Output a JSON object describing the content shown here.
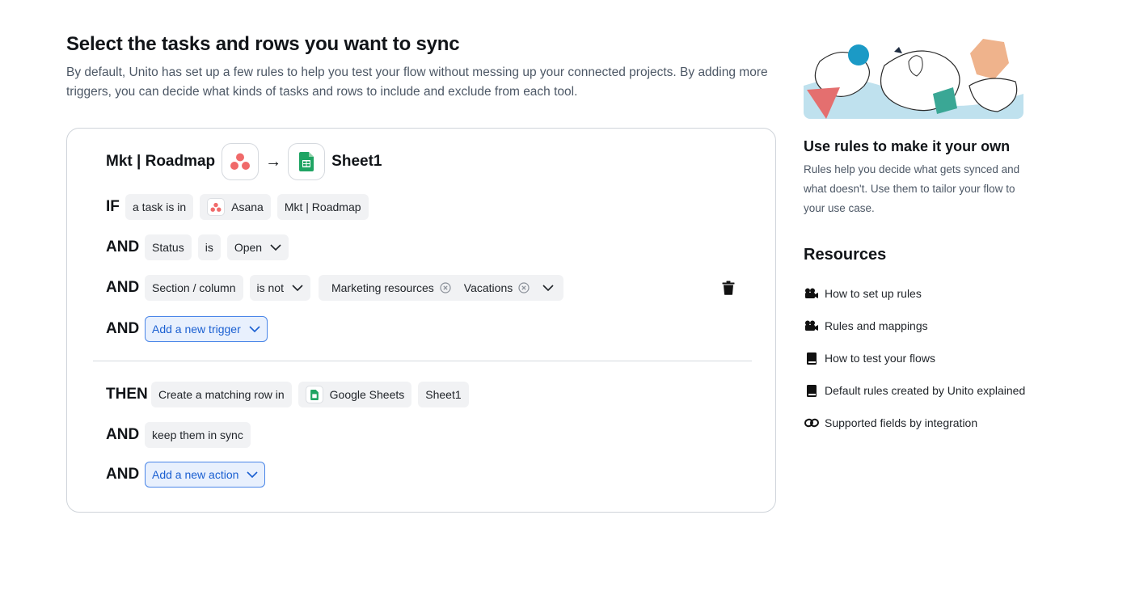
{
  "page": {
    "title": "Select the tasks and rows you want to sync",
    "description": "By default, Unito has set up a few rules to help you test your flow without messing up your connected projects. By adding more triggers, you can decide what kinds of tasks and rows to include and exclude from each tool."
  },
  "flow": {
    "source_name": "Mkt | Roadmap",
    "arrow": "→",
    "target_name": "Sheet1"
  },
  "triggers": {
    "if_keyword": "IF",
    "if_chip": "a task is in",
    "if_tool": "Asana",
    "if_project": "Mkt | Roadmap",
    "status": {
      "keyword": "AND",
      "field": "Status",
      "operator": "is",
      "value": "Open"
    },
    "section": {
      "keyword": "AND",
      "field": "Section / column",
      "operator": "is not",
      "values": [
        "Marketing resources",
        "Vacations"
      ]
    },
    "add": {
      "keyword": "AND",
      "label": "Add a new trigger"
    }
  },
  "actions": {
    "then_keyword": "THEN",
    "then_chip": "Create a matching row in",
    "then_tool": "Google Sheets",
    "then_sheet": "Sheet1",
    "sync": {
      "keyword": "AND",
      "label": "keep them in sync"
    },
    "add": {
      "keyword": "AND",
      "label": "Add a new action"
    }
  },
  "sidebar": {
    "title": "Use rules to make it your own",
    "description": "Rules help you decide what gets synced and what doesn't. Use them to tailor your flow to your use case.",
    "resources_title": "Resources",
    "resources": [
      {
        "label": "How to set up rules",
        "icon": "video-icon"
      },
      {
        "label": "Rules and mappings",
        "icon": "video-icon"
      },
      {
        "label": "How to test your flows",
        "icon": "book-icon"
      },
      {
        "label": "Default rules created by Unito explained",
        "icon": "book-icon"
      },
      {
        "label": "Supported fields by integration",
        "icon": "link-icon"
      }
    ]
  },
  "colors": {
    "accent": "#1a5fd1",
    "asana": "#f06a6a",
    "sheets": "#1fa463",
    "illustration_bg": "#c7e3ef"
  }
}
